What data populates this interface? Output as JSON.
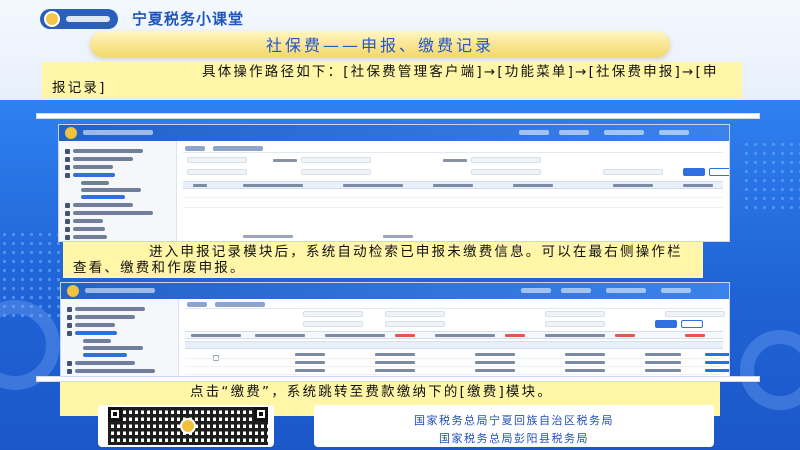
{
  "header": {
    "brand": "宁夏税务小课堂"
  },
  "title": "社保费——申报、缴费记录",
  "notes": {
    "path": "具体操作路径如下：[社保费管理客户端]→[功能菜单]→[社保费申报]→[申报记录]",
    "detect": "进入申报记录模块后，系统自动检索已申报未缴费信息。可以在最右侧操作栏查看、缴费和作废申报。",
    "pay": "点击“缴费”，系统跳转至费款缴纳下的[缴费]模块。"
  },
  "footer": {
    "line1": "国家税务总局宁夏回族自治区税务局",
    "line2": "国家税务总局彭阳县税务局"
  },
  "colors": {
    "brand_blue": "#1f56b8",
    "banner_gold": "#f4d86a",
    "note_yellow": "#fff6a8",
    "background_blue": "#2f80f0"
  },
  "icons": {
    "logo": "tax-bureau-emblem-icon",
    "qr": "qr-code"
  }
}
